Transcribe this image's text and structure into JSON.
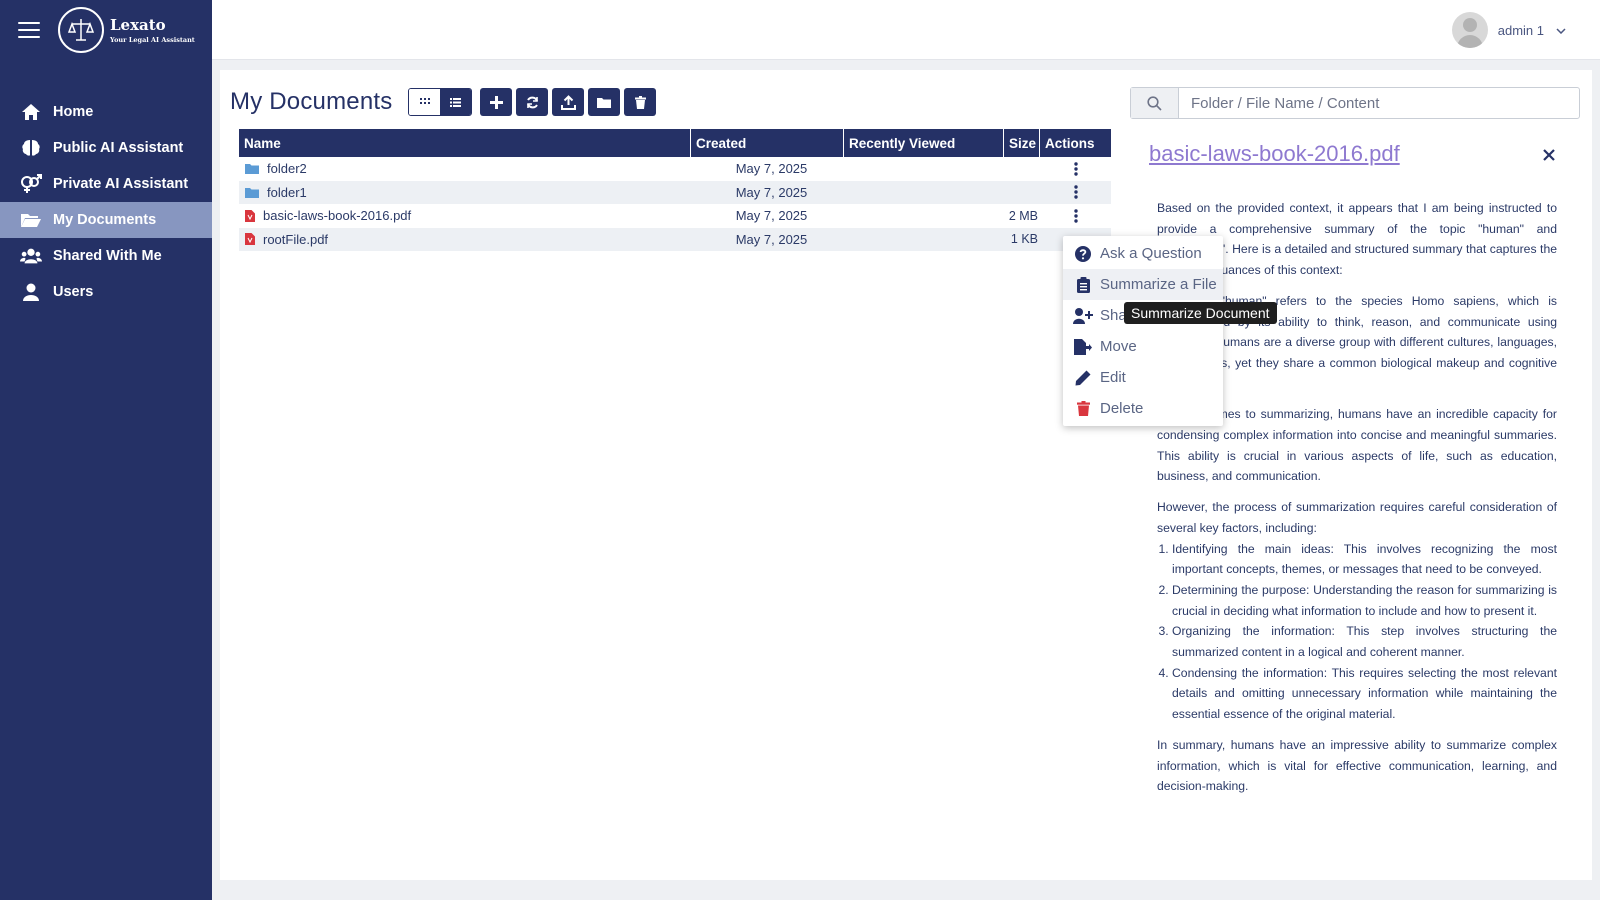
{
  "brand": {
    "name": "Lexato",
    "tagline": "Your Legal AI Assistant"
  },
  "sidebar": {
    "items": [
      {
        "label": "Home",
        "icon": "home-icon"
      },
      {
        "label": "Public AI Assistant",
        "icon": "brain-icon"
      },
      {
        "label": "Private AI Assistant",
        "icon": "venus-mars-icon"
      },
      {
        "label": "My Documents",
        "icon": "folder-open-icon",
        "active": true
      },
      {
        "label": "Shared With Me",
        "icon": "users-icon"
      },
      {
        "label": "Users",
        "icon": "user-icon"
      }
    ]
  },
  "topbar": {
    "username": "admin 1"
  },
  "page": {
    "title": "My Documents"
  },
  "table": {
    "columns": [
      "Name",
      "Created",
      "Recently Viewed",
      "Size",
      "Actions"
    ],
    "rows": [
      {
        "type": "folder",
        "name": "folder2",
        "created": "May 7, 2025",
        "viewed": "",
        "size": ""
      },
      {
        "type": "folder",
        "name": "folder1",
        "created": "May 7, 2025",
        "viewed": "",
        "size": ""
      },
      {
        "type": "pdf",
        "name": "basic-laws-book-2016.pdf",
        "created": "May 7, 2025",
        "viewed": "",
        "size": "2 MB"
      },
      {
        "type": "pdf",
        "name": "rootFile.pdf",
        "created": "May 7, 2025",
        "viewed": "",
        "size": "1 KB"
      }
    ]
  },
  "menu": {
    "items": [
      "Ask a Question",
      "Summarize a File",
      "Share",
      "Move",
      "Edit",
      "Delete"
    ],
    "tooltip": "Summarize Document"
  },
  "search": {
    "placeholder": "Folder / File Name / Content"
  },
  "summary": {
    "title": "basic-laws-book-2016.pdf",
    "p1": "Based on the provided context, it appears that I am being instructed to provide a comprehensive summary of the topic \"human\" and \"summarize\". Here is a detailed and structured summary that captures the depth and nuances of this context:",
    "p2": "The term \"human\" refers to the species Homo sapiens, which is characterized by its ability to think, reason, and communicate using language. Humans are a diverse group with different cultures, languages, and customs, yet they share a common biological makeup and cognitive abilities.",
    "p3": "When it comes to summarizing, humans have an incredible capacity for condensing complex information into concise and meaningful summaries. This ability is crucial in various aspects of life, such as education, business, and communication.",
    "p4": "However, the process of summarization requires careful consideration of several key factors, including:",
    "list": [
      "Identifying the main ideas: This involves recognizing the most important concepts, themes, or messages that need to be conveyed.",
      "Determining the purpose: Understanding the reason for summarizing is crucial in deciding what information to include and how to present it.",
      "Organizing the information: This step involves structuring the summarized content in a logical and coherent manner.",
      "Condensing the information: This requires selecting the most relevant details and omitting unnecessary information while maintaining the essential essence of the original material."
    ],
    "p5": "In summary, humans have an impressive ability to summarize complex information, which is vital for effective communication, learning, and decision-making."
  },
  "colors": {
    "navy": "#253166",
    "active": "#8796c0",
    "folder": "#5b9bd5",
    "pdf": "#d9363e",
    "link": "#8e79d0"
  }
}
